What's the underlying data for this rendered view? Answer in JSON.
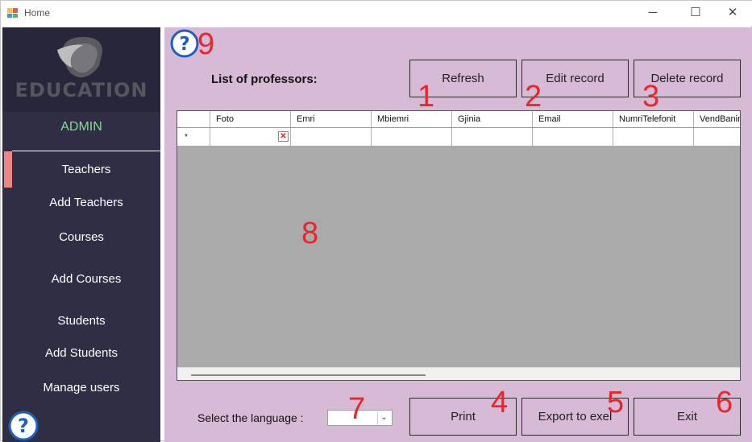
{
  "window": {
    "title": "Home",
    "minimize_glyph": "─",
    "maximize_glyph": "☐",
    "close_glyph": "✕"
  },
  "sidebar": {
    "logo_text": "EDUCATION",
    "role": "ADMIN",
    "items": [
      {
        "label": "Teachers",
        "active": true
      },
      {
        "label": "Add Teachers"
      },
      {
        "label": "Courses"
      },
      {
        "label": "Add Courses"
      },
      {
        "label": "Students"
      },
      {
        "label": "Add Students"
      },
      {
        "label": "Manage users"
      }
    ]
  },
  "main": {
    "list_label": "List of professors:",
    "buttons": {
      "refresh": "Refresh",
      "edit": "Edit record",
      "delete": "Delete record",
      "print": "Print",
      "export": "Export to exel",
      "exit": "Exit"
    },
    "grid": {
      "columns": [
        "Foto",
        "Emri",
        "Mbiemri",
        "Gjinia",
        "Email",
        "NumriTelefonit",
        "VendBanimi"
      ],
      "new_row_marker": "*",
      "broken_image_glyph": "✕"
    },
    "language": {
      "label": "Select the language :",
      "value": "",
      "arrow_glyph": "⌄"
    }
  },
  "annotations": [
    "1",
    "2",
    "3",
    "4",
    "5",
    "6",
    "7",
    "8",
    "9"
  ],
  "colors": {
    "sidebar_bg": "#2f2e45",
    "main_bg": "#d7bad6",
    "admin_text": "#7ee08f",
    "active_marker": "#f08585",
    "annotation_red": "#e8262b",
    "help_blue": "#1f5fbf"
  }
}
